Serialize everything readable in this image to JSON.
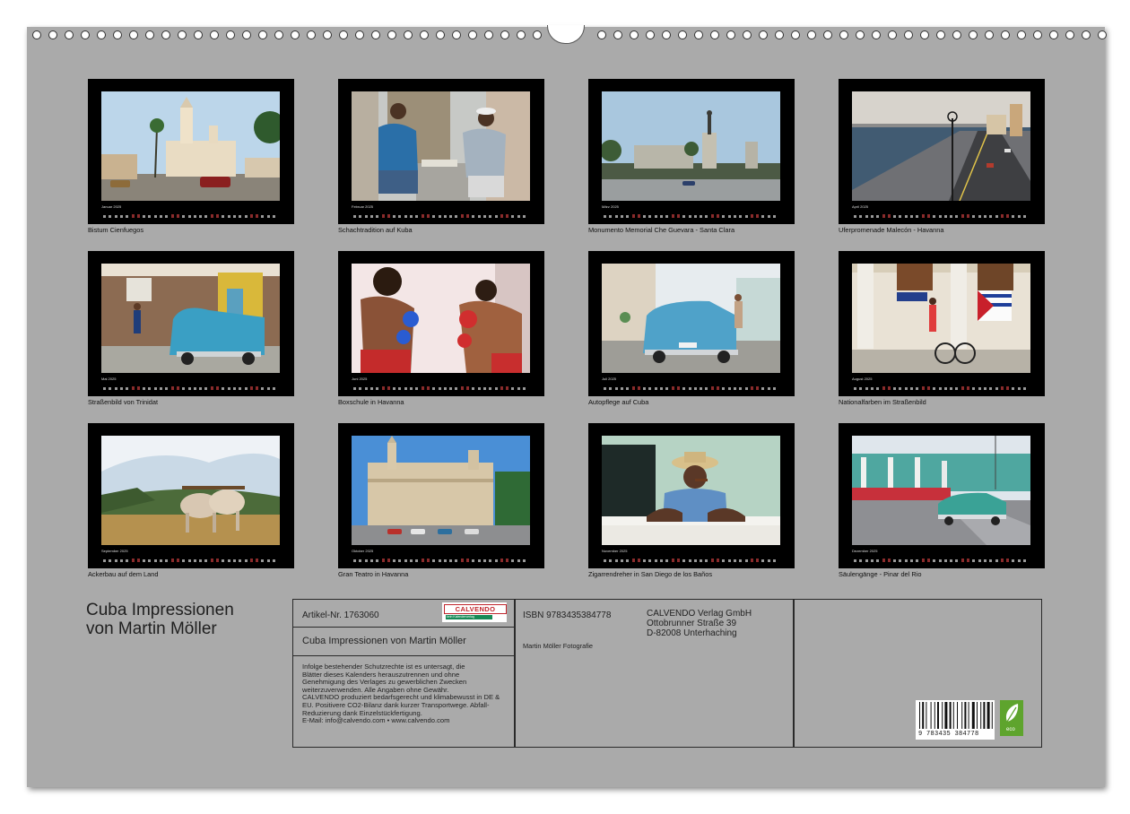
{
  "months": [
    {
      "label": "Januar 2025",
      "caption": "Bistum Cienfuegos",
      "scene": "cathedral"
    },
    {
      "label": "Februar 2025",
      "caption": "Schachtradition auf Kuba",
      "scene": "chess"
    },
    {
      "label": "März 2025",
      "caption": "Monumento Memorial Che Guevara - Santa Clara",
      "scene": "monument"
    },
    {
      "label": "April 2025",
      "caption": "Uferpromenade Malecón - Havanna",
      "scene": "malecon"
    },
    {
      "label": "Mai 2025",
      "caption": "Straßenbild von Trinidat",
      "scene": "street"
    },
    {
      "label": "Juni 2025",
      "caption": "Boxschule in Havanna",
      "scene": "boxing"
    },
    {
      "label": "Juli 2025",
      "caption": "Autopflege auf Cuba",
      "scene": "carcare"
    },
    {
      "label": "August 2025",
      "caption": "Nationalfarben im Straßenbild",
      "scene": "flag"
    },
    {
      "label": "September 2025",
      "caption": "Ackerbau auf dem Land",
      "scene": "oxen"
    },
    {
      "label": "Oktober 2025",
      "caption": "Gran Teatro in Havanna",
      "scene": "theatre"
    },
    {
      "label": "November 2025",
      "caption": "Zigarrendreher in San Diego de los Baños",
      "scene": "cigar"
    },
    {
      "label": "Dezember 2025",
      "caption": "Säulengänge - Pinar del Rio",
      "scene": "columns"
    }
  ],
  "title_line1": "Cuba Impressionen",
  "title_line2": "von Martin Möller",
  "info": {
    "artikel": "Artikel-Nr. 1763060",
    "brand": "CALVENDO",
    "brand_tagline": "kein Kalender­verlag",
    "subtitle": "Cuba Impressionen von Martin Möller",
    "legal": [
      "Infolge bestehender Schutzrechte ist es untersagt, die",
      "Blätter dieses Kalenders herauszutrennen und ohne",
      "Genehmigung des Verlages zu gewerblichen Zwecken",
      "weiterzuverwenden. Alle Angaben ohne Gewähr.",
      "CALVENDO produziert bedarfsgerecht und klimabewusst in DE &",
      "EU. Positivere CO2-Bilanz dank kurzer Transportwege. Abfall-",
      "Reduzierung dank Einzelstückfertigung.",
      "E-Mail: info@calvendo.com • www.calvendo.com"
    ],
    "isbn": "ISBN 9783435384778",
    "photographer": "Martin Möller Fotografie",
    "publisher_lines": [
      "CALVENDO Verlag GmbH",
      "Ottobrunner Straße 39",
      "D-82008 Unterhaching"
    ],
    "barcode_number": "9 783435 384778",
    "eco_label": "eco"
  },
  "colors": {
    "page": "#aaaaaa",
    "frame": "#000000",
    "border": "#2a2a2a",
    "calvendo_red": "#c0262d",
    "eco_green": "#5ea42d"
  }
}
